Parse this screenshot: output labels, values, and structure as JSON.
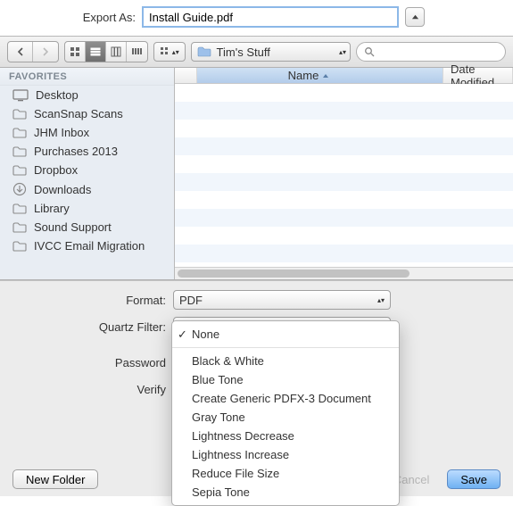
{
  "export": {
    "label": "Export As:",
    "value": "Install Guide.pdf"
  },
  "toolbar": {
    "path": "Tim's Stuff",
    "search_placeholder": ""
  },
  "sidebar": {
    "header": "FAVORITES",
    "items": [
      "Desktop",
      "ScanSnap Scans",
      "JHM Inbox",
      "Purchases 2013",
      "Dropbox",
      "Downloads",
      "Library",
      "Sound Support",
      "IVCC Email Migration"
    ]
  },
  "columns": {
    "name": "Name",
    "date": "Date Modified"
  },
  "format_row": {
    "label": "Format:",
    "value": "PDF"
  },
  "quartz": {
    "label": "Quartz Filter:",
    "selected": "None",
    "options": [
      "None",
      "Black & White",
      "Blue Tone",
      "Create Generic PDFX-3 Document",
      "Gray Tone",
      "Lightness Decrease",
      "Lightness Increase",
      "Reduce File Size",
      "Sepia Tone"
    ]
  },
  "password_label": "Password",
  "verify_label": "Verify",
  "buttons": {
    "new_folder": "New Folder",
    "cancel": "Cancel",
    "save": "Save"
  }
}
